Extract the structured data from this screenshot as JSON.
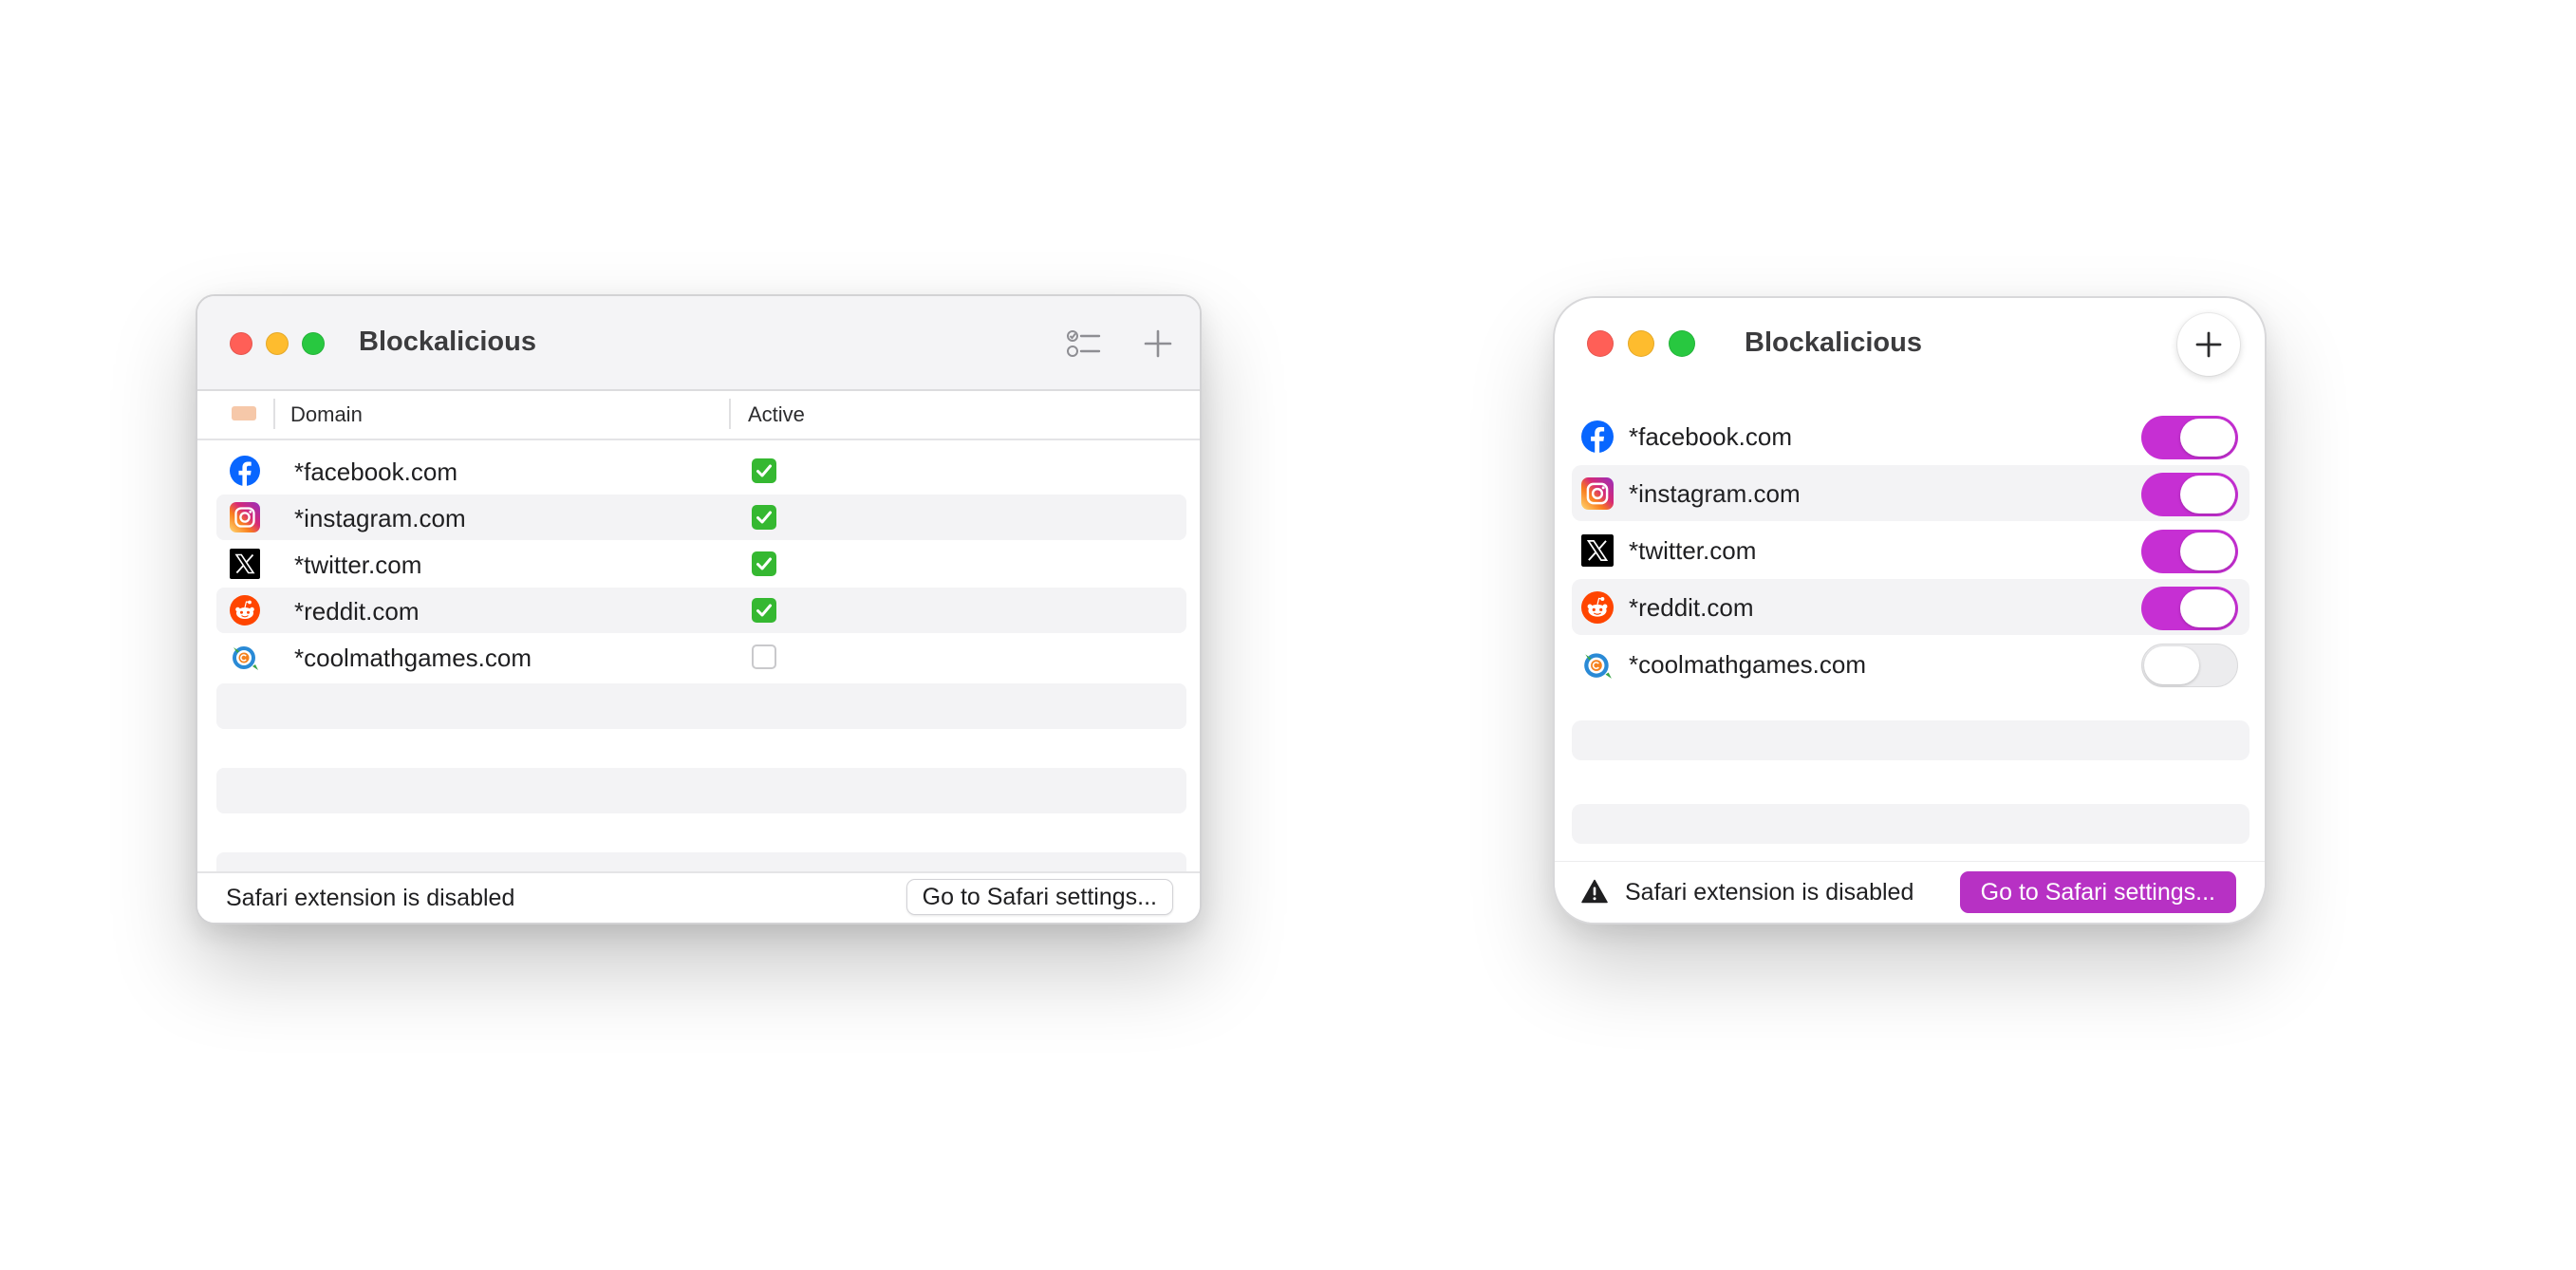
{
  "left_window": {
    "title": "Blockalicious",
    "toolbar": {
      "list_icon": "checklist-icon",
      "add_icon": "plus-icon"
    },
    "columns": {
      "domain": "Domain",
      "active": "Active"
    },
    "sites": [
      {
        "domain": "*facebook.com",
        "icon": "facebook-icon",
        "active": true
      },
      {
        "domain": "*instagram.com",
        "icon": "instagram-icon",
        "active": true
      },
      {
        "domain": "*twitter.com",
        "icon": "x-twitter-icon",
        "active": true
      },
      {
        "domain": "*reddit.com",
        "icon": "reddit-icon",
        "active": true
      },
      {
        "domain": "*coolmathgames.com",
        "icon": "coolmathgames-icon",
        "active": false
      }
    ],
    "status": {
      "text": "Safari extension is disabled",
      "button": "Go to Safari settings..."
    }
  },
  "right_window": {
    "title": "Blockalicious",
    "toolbar": {
      "add_icon": "plus-icon"
    },
    "sites": [
      {
        "domain": "*facebook.com",
        "icon": "facebook-icon",
        "active": true
      },
      {
        "domain": "*instagram.com",
        "icon": "instagram-icon",
        "active": true
      },
      {
        "domain": "*twitter.com",
        "icon": "x-twitter-icon",
        "active": true
      },
      {
        "domain": "*reddit.com",
        "icon": "reddit-icon",
        "active": true
      },
      {
        "domain": "*coolmathgames.com",
        "icon": "coolmathgames-icon",
        "active": false
      }
    ],
    "status": {
      "text": "Safari extension is disabled",
      "button": "Go to Safari settings...",
      "icon": "warning-icon"
    }
  },
  "colors": {
    "traffic_red": "#ff5f57",
    "traffic_yellow": "#febc2e",
    "traffic_green": "#28c840",
    "checkbox_on": "#35b831",
    "toggle_on": "#c62fd3",
    "accent_button": "#b731c4"
  }
}
